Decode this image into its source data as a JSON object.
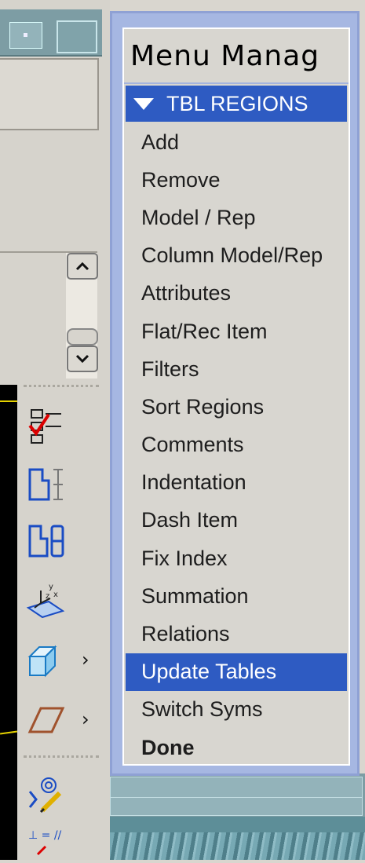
{
  "menu_manager": {
    "title": "Menu Manag",
    "section_header": "TBL REGIONS",
    "items": [
      {
        "label": "Add"
      },
      {
        "label": "Remove"
      },
      {
        "label": "Model / Rep"
      },
      {
        "label": "Column Model/Rep"
      },
      {
        "label": "Attributes"
      },
      {
        "label": "Flat/Rec Item"
      },
      {
        "label": "Filters"
      },
      {
        "label": "Sort Regions"
      },
      {
        "label": "Comments"
      },
      {
        "label": "Indentation"
      },
      {
        "label": "Dash Item"
      },
      {
        "label": "Fix Index"
      },
      {
        "label": "Summation"
      },
      {
        "label": "Relations"
      },
      {
        "label": "Update Tables"
      },
      {
        "label": "Switch Syms"
      },
      {
        "label": "Done"
      }
    ],
    "selected_item": "Update Tables",
    "accent_color": "#2e5bc2"
  },
  "toolbar": {
    "icons": [
      "table-check-icon",
      "dimension-table-icon",
      "split-table-icon",
      "csys-plane-icon",
      "cube-icon",
      "parallelogram-plane-icon",
      "sensor-pen-icon",
      "constraint-icon"
    ]
  }
}
